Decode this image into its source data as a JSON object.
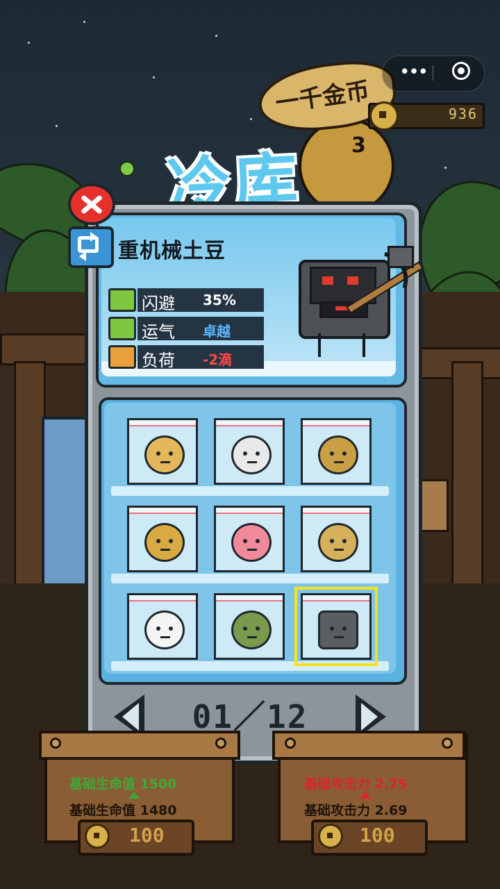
{
  "header": {
    "title": "冷库",
    "banner_text": "一千金币",
    "coins": "936"
  },
  "character": {
    "name": "重机械土豆",
    "stats": [
      {
        "label": "闪避",
        "value": "35%",
        "value_color": "#ffffff",
        "icon": "dodge-potato-icon",
        "icon_color": "#7ec840"
      },
      {
        "label": "运气",
        "value": "卓越",
        "value_color": "#5bb8ff",
        "icon": "luck-clover-icon",
        "icon_color": "#7ec840"
      },
      {
        "label": "负荷",
        "value": "-2滴",
        "value_color": "#ff4a4a",
        "icon": "load-crate-icon",
        "icon_color": "#e9a23b"
      }
    ]
  },
  "grid": {
    "items": [
      {
        "name": "plain-potato",
        "color": "#e4b85a"
      },
      {
        "name": "bandage-potato",
        "color": "#e9e9e9"
      },
      {
        "name": "dark-potato",
        "color": "#caa046"
      },
      {
        "name": "shouting-potato",
        "color": "#d9aa42"
      },
      {
        "name": "pink-potato",
        "color": "#f08a9b"
      },
      {
        "name": "crying-potato",
        "color": "#d6b05a"
      },
      {
        "name": "ghost-potato",
        "color": "#f4f4f4"
      },
      {
        "name": "moss-potato",
        "color": "#7a9a4e"
      },
      {
        "name": "heavy-machine-potato",
        "color": "#5a5e63"
      }
    ],
    "selected_index": 8
  },
  "pager": {
    "text": "01／12"
  },
  "crates": {
    "left": {
      "upgrade_stat": "基础生命值 1500",
      "upgrade_color": "#3fa83a",
      "base_stat": "基础生命值 1480",
      "price": "100"
    },
    "right": {
      "upgrade_stat": "基础攻击力 2.75",
      "upgrade_color": "#d8262a",
      "base_stat": "基础攻击力 2.69",
      "price": "100"
    }
  }
}
